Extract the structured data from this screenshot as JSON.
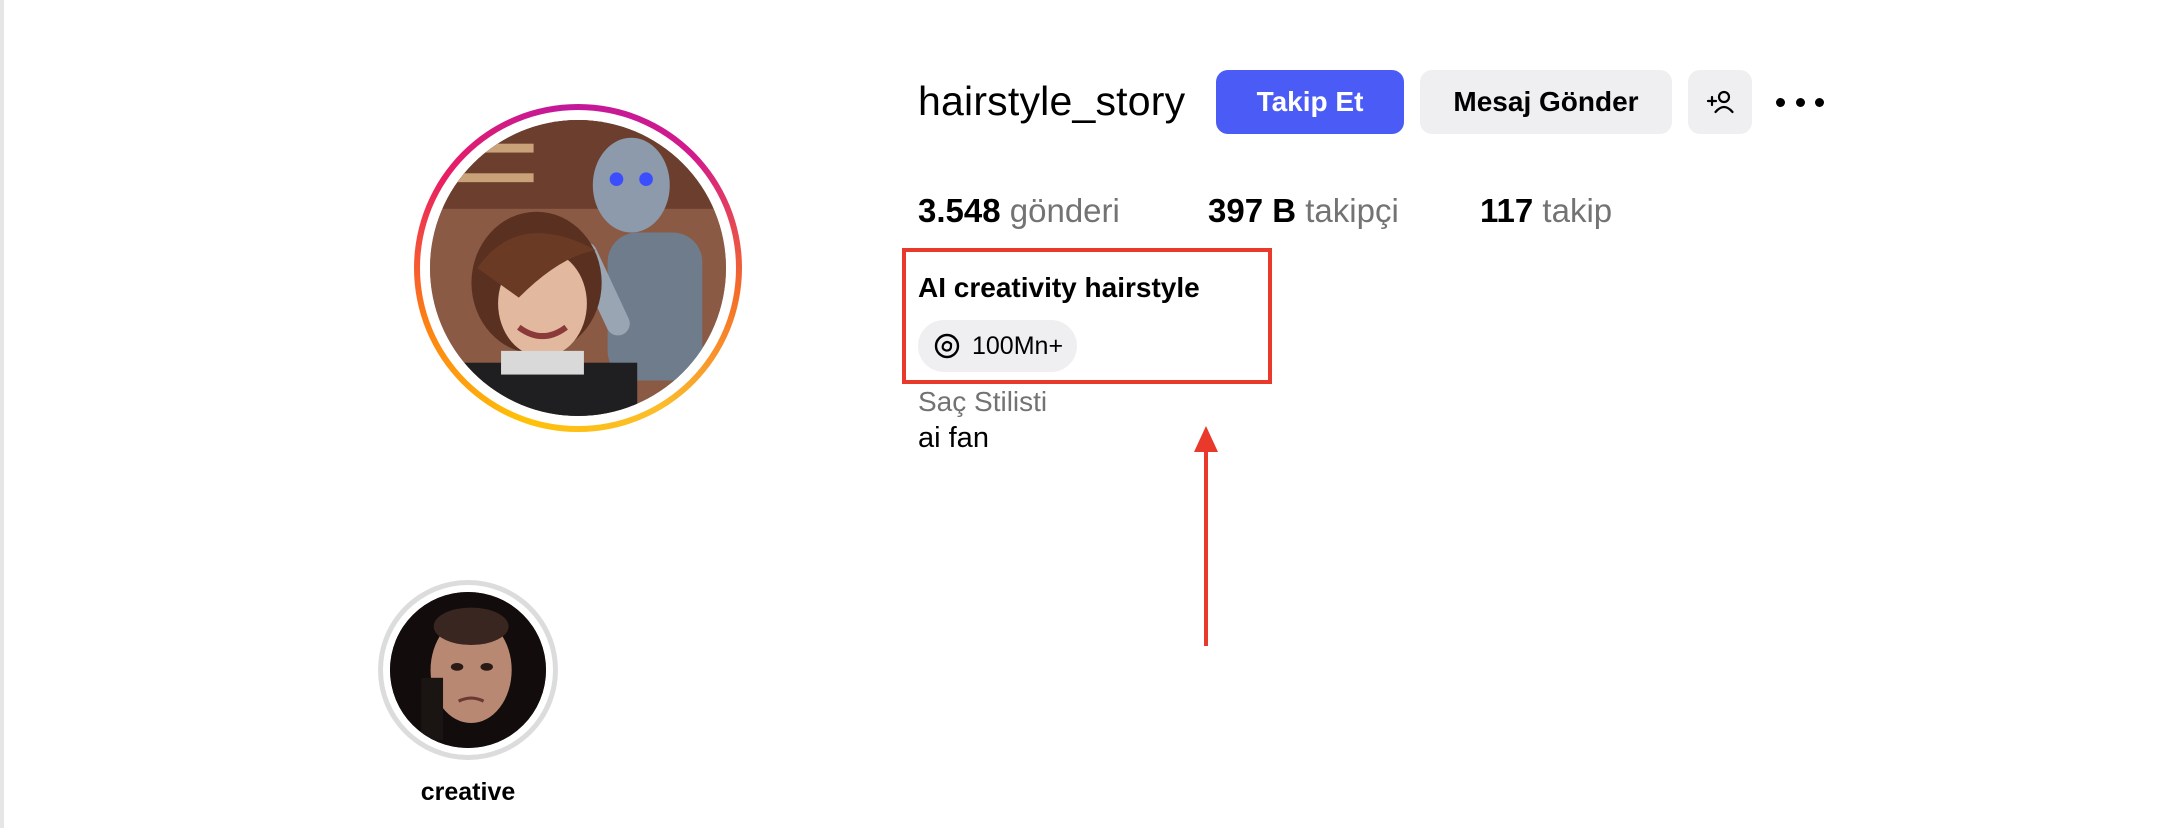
{
  "profile": {
    "username": "hairstyle_story",
    "full_name": "AI creativity hairstyle",
    "threads_badge": "100Mn+",
    "category": "Saç Stilisti",
    "bio": "ai fan"
  },
  "actions": {
    "follow_label": "Takip Et",
    "message_label": "Mesaj Gönder",
    "add_user_icon": "add-user-icon",
    "more_icon": "more-options-icon"
  },
  "stats": {
    "posts_count": "3.548",
    "posts_label": "gönderi",
    "followers_count": "397 B",
    "followers_label": "takipçi",
    "following_count": "117",
    "following_label": "takip"
  },
  "highlights": [
    {
      "label": "creative"
    }
  ],
  "colors": {
    "primary_button": "#4a5cf5",
    "secondary_button": "#efeff2",
    "muted_text": "#737373",
    "annotation": "#e8392a"
  }
}
